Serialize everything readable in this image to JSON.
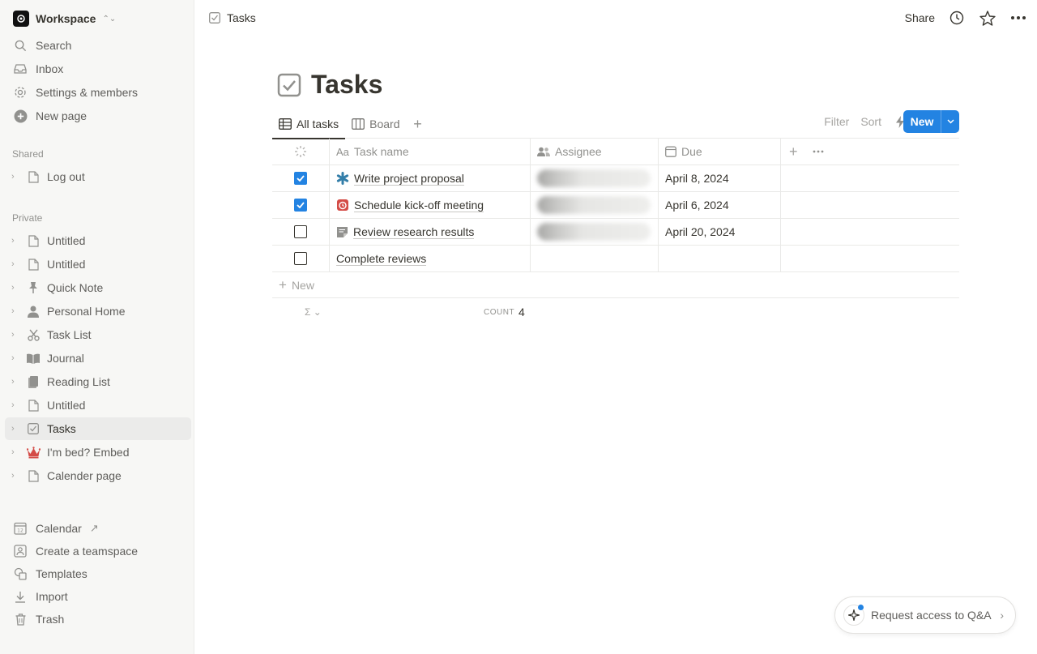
{
  "workspace": {
    "name": "Workspace",
    "logo_icon": "workspace-logo-icon"
  },
  "nav": [
    {
      "label": "Search",
      "icon": "search-icon"
    },
    {
      "label": "Inbox",
      "icon": "inbox-icon"
    },
    {
      "label": "Settings & members",
      "icon": "gear-icon"
    },
    {
      "label": "New page",
      "icon": "plus-circle-icon"
    }
  ],
  "shared": {
    "label": "Shared",
    "pages": [
      {
        "label": "Log out",
        "icon": "page-icon"
      }
    ]
  },
  "private": {
    "label": "Private",
    "pages": [
      {
        "label": "Untitled",
        "icon": "page-icon"
      },
      {
        "label": "Untitled",
        "icon": "page-icon"
      },
      {
        "label": "Quick Note",
        "icon": "pin-icon"
      },
      {
        "label": "Personal Home",
        "icon": "person-icon"
      },
      {
        "label": "Task List",
        "icon": "scissors-icon"
      },
      {
        "label": "Journal",
        "icon": "book-icon"
      },
      {
        "label": "Reading List",
        "icon": "books-icon"
      },
      {
        "label": "Untitled",
        "icon": "page-icon"
      },
      {
        "label": "Tasks",
        "icon": "checkbox-icon"
      },
      {
        "label": "I'm bed? Embed",
        "icon": "crown-icon"
      },
      {
        "label": "Calender page",
        "icon": "page-icon"
      }
    ]
  },
  "bottom": [
    {
      "label": "Calendar",
      "icon": "calendar-icon"
    },
    {
      "label": "Create a teamspace",
      "icon": "teamspace-icon"
    },
    {
      "label": "Templates",
      "icon": "templates-icon"
    },
    {
      "label": "Import",
      "icon": "import-icon"
    },
    {
      "label": "Trash",
      "icon": "trash-icon"
    }
  ],
  "topbar": {
    "breadcrumb": "Tasks",
    "share": "Share"
  },
  "page": {
    "title": "Tasks"
  },
  "tabs": [
    {
      "label": "All tasks"
    },
    {
      "label": "Board"
    }
  ],
  "toolbar": {
    "filter": "Filter",
    "sort": "Sort",
    "new": "New"
  },
  "table": {
    "headers": {
      "name": "Task name",
      "name_prefix": "Aa",
      "assignee": "Assignee",
      "due": "Due"
    },
    "rows": [
      {
        "checked": true,
        "icon": "asterisk-icon",
        "name": "Write project proposal",
        "due": "April 8, 2024"
      },
      {
        "checked": true,
        "icon": "alarm-clock-icon",
        "name": "Schedule kick-off meeting",
        "due": "April 6, 2024"
      },
      {
        "checked": false,
        "icon": "note-icon",
        "name": "Review research results",
        "due": "April 20, 2024"
      },
      {
        "checked": false,
        "icon": "",
        "name": "Complete reviews",
        "due": ""
      }
    ],
    "new_row": "New",
    "count_label": "COUNT",
    "count_value": "4"
  },
  "qa": {
    "label": "Request access to Q&A"
  },
  "colors": {
    "accent": "#2383e2",
    "sidebar_bg": "#f7f7f5",
    "text": "#37352f"
  }
}
